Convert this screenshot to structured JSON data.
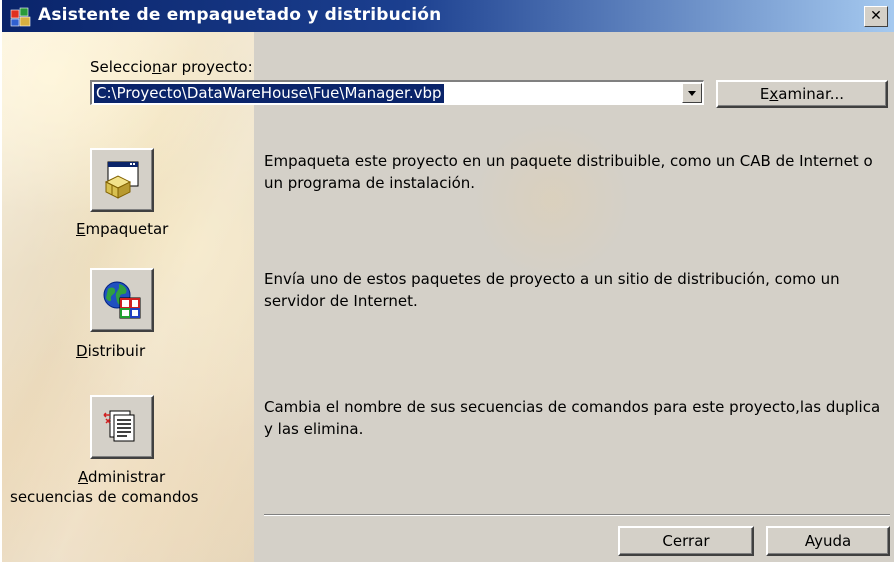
{
  "window": {
    "title": "Asistente de empaquetado y distribución",
    "close_label": "✕"
  },
  "project": {
    "label_before": "Seleccio",
    "label_underlined": "n",
    "label_after": "ar proyecto:",
    "selected_path": "C:\\Proyecto\\DataWareHouse\\Fue\\Manager.vbp",
    "browse_before": "E",
    "browse_underlined": "x",
    "browse_after": "aminar..."
  },
  "actions": [
    {
      "name_underlined": "E",
      "name_rest": "mpaquetar",
      "icon": "package-icon",
      "description": "Empaqueta este proyecto en un paquete distribuible, como un CAB de Internet o un programa de instalación."
    },
    {
      "name_underlined": "D",
      "name_rest": "istribuir",
      "icon": "globe-deploy-icon",
      "description": "Envía uno de estos paquetes de proyecto a un sitio de distribución, como un servidor de Internet."
    },
    {
      "name_underlined": "A",
      "name_rest": "dministrar",
      "name_line2": "secuencias de comandos",
      "icon": "scripts-icon",
      "description": "Cambia el nombre de sus secuencias de comandos para este proyecto,las duplica y las elimina."
    }
  ],
  "footer": {
    "close_label": "Cerrar",
    "help_label": "Ayuda"
  },
  "colors": {
    "titlebar_start": "#0a246a",
    "titlebar_end": "#a6caf0",
    "selection": "#0a246a",
    "dialog_face": "#d4d0c8"
  }
}
